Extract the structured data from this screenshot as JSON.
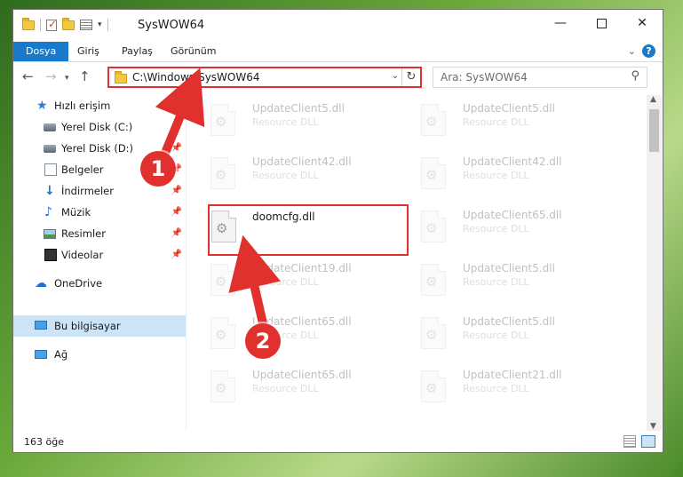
{
  "window": {
    "title": "SysWOW64",
    "controls": {
      "minimize": "—",
      "maximize": "",
      "close": "✕"
    }
  },
  "ribbon": {
    "tabs": [
      "Dosya",
      "Giriş",
      "Paylaş",
      "Görünüm"
    ],
    "help": "?"
  },
  "navigation": {
    "address_path": "C:\\Windows\\SysWOW64",
    "search_placeholder": "Ara: SysWOW64"
  },
  "sidebar": {
    "items": [
      {
        "label": "Hızlı erişim",
        "icon": "star-icon"
      },
      {
        "label": "Yerel Disk (C:)",
        "icon": "drive-icon",
        "pinned": true
      },
      {
        "label": "Yerel Disk (D:)",
        "icon": "drive-icon",
        "pinned": true
      },
      {
        "label": "Belgeler",
        "icon": "documents-icon",
        "pinned": true
      },
      {
        "label": "İndirmeler",
        "icon": "download-icon",
        "pinned": true
      },
      {
        "label": "Müzik",
        "icon": "music-icon",
        "pinned": true
      },
      {
        "label": "Resimler",
        "icon": "pictures-icon",
        "pinned": true
      },
      {
        "label": "Videolar",
        "icon": "videos-icon",
        "pinned": true
      },
      {
        "label": "OneDrive",
        "icon": "cloud-icon"
      },
      {
        "label": "Bu bilgisayar",
        "icon": "computer-icon",
        "selected": true
      },
      {
        "label": "Ağ",
        "icon": "network-icon"
      }
    ]
  },
  "files": [
    {
      "name": "UpdateClient5.dll",
      "desc": "Resource DLL"
    },
    {
      "name": "UpdateClient5.dll",
      "desc": "Resource DLL"
    },
    {
      "name": "UpdateClient42.dll",
      "desc": "Resource DLL"
    },
    {
      "name": "UpdateClient42.dll",
      "desc": "Resource DLL"
    },
    {
      "name": "doomcfg.dll",
      "desc": ""
    },
    {
      "name": "UpdateClient65.dll",
      "desc": "Resource DLL"
    },
    {
      "name": "UpdateClient19.dll",
      "desc": "Resource DLL"
    },
    {
      "name": "UpdateClient5.dll",
      "desc": "Resource DLL"
    },
    {
      "name": "UpdateClient65.dll",
      "desc": "Resource DLL"
    },
    {
      "name": "UpdateClient5.dll",
      "desc": "Resource DLL"
    },
    {
      "name": "UpdateClient65.dll",
      "desc": "Resource DLL"
    },
    {
      "name": "UpdateClient21.dll",
      "desc": "Resource DLL"
    }
  ],
  "status": {
    "item_count": "163 öğe"
  },
  "annotations": {
    "step1": "1",
    "step2": "2",
    "color": "#e0312f"
  }
}
